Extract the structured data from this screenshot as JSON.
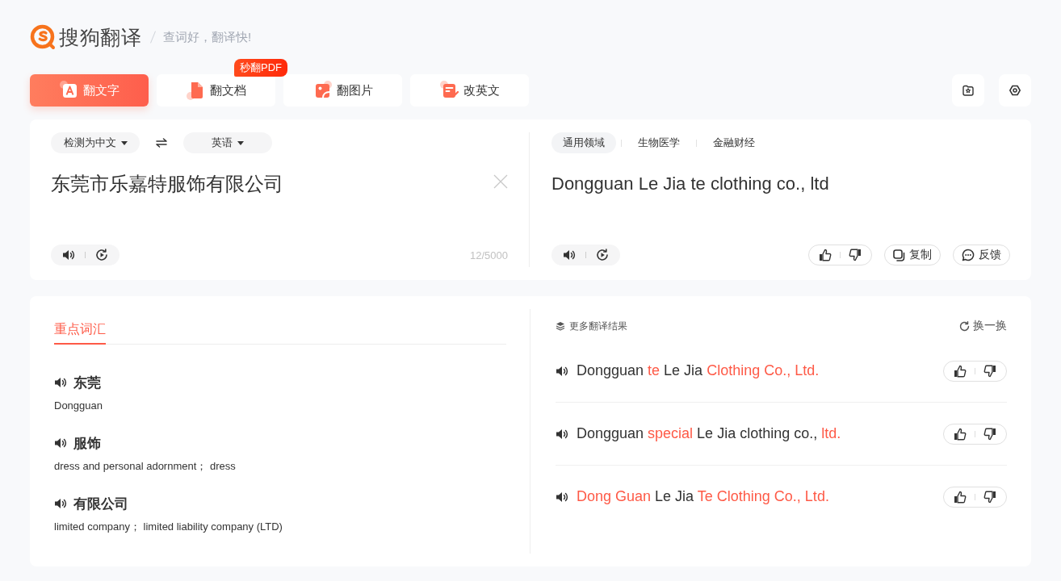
{
  "header": {
    "logo_text": "搜狗翻译",
    "slogan": "查词好，翻译快!"
  },
  "tabs": [
    {
      "label": "翻文字",
      "selected": true
    },
    {
      "label": "翻文档",
      "selected": false,
      "badge": "秒翻PDF"
    },
    {
      "label": "翻图片",
      "selected": false
    },
    {
      "label": "改英文",
      "selected": false
    }
  ],
  "source": {
    "language": "检测为中文",
    "text": "东莞市乐嘉特服饰有限公司",
    "char_count": "12/5000"
  },
  "target": {
    "language": "英语",
    "domains": [
      {
        "label": "通用领域",
        "selected": true
      },
      {
        "label": "生物医学",
        "selected": false
      },
      {
        "label": "金融财经",
        "selected": false
      }
    ],
    "text": "Dongguan Le Jia te clothing co., ltd",
    "copy_label": "复制",
    "feedback_label": "反馈"
  },
  "vocabulary": {
    "tabs": [
      {
        "label": "重点词汇",
        "selected": true
      }
    ],
    "entries": [
      {
        "word": "东莞",
        "meaning": "Dongguan"
      },
      {
        "word": "服饰",
        "meaning": "dress and personal adornment； dress"
      },
      {
        "word": "有限公司",
        "meaning": "limited company； limited liability company (LTD)"
      }
    ]
  },
  "more_results": {
    "title": "更多翻译结果",
    "refresh_label": "换一换",
    "items": [
      {
        "segments": [
          {
            "text": "Dongguan ",
            "highlight": false
          },
          {
            "text": "te",
            "highlight": true
          },
          {
            "text": " Le Jia ",
            "highlight": false
          },
          {
            "text": "Clothing Co., Ltd.",
            "highlight": true
          }
        ]
      },
      {
        "segments": [
          {
            "text": "Dongguan ",
            "highlight": false
          },
          {
            "text": "special",
            "highlight": true
          },
          {
            "text": " Le Jia clothing co., ",
            "highlight": false
          },
          {
            "text": "ltd.",
            "highlight": true
          }
        ]
      },
      {
        "segments": [
          {
            "text": "Dong Guan",
            "highlight": true
          },
          {
            "text": " Le Jia ",
            "highlight": false
          },
          {
            "text": "Te Clothing Co., Ltd.",
            "highlight": true
          }
        ]
      }
    ]
  }
}
